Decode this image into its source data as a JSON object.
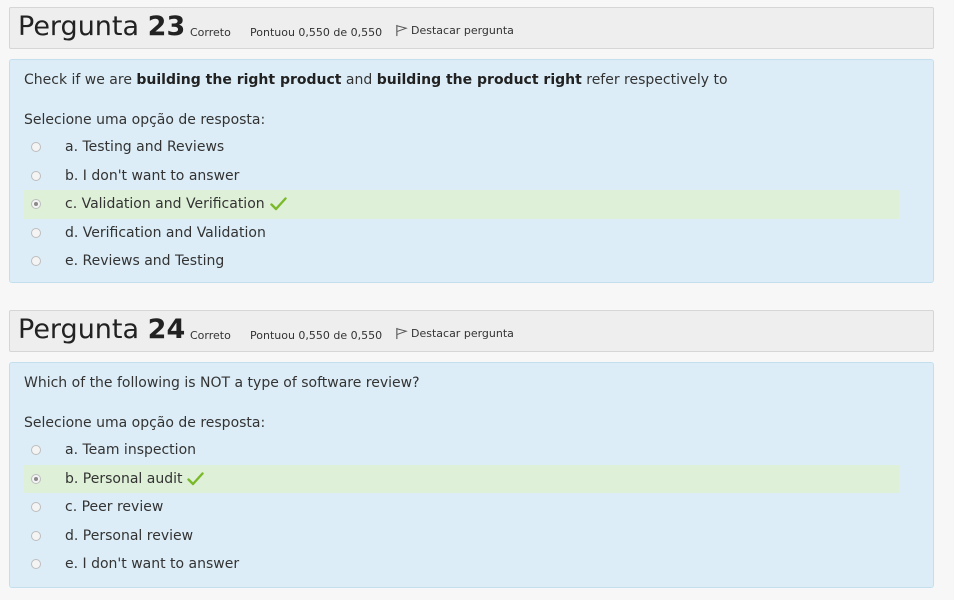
{
  "questions": [
    {
      "title_word": "Pergunta",
      "number": "23",
      "state": "Correto",
      "grade": "Pontuou 0,550 de 0,550",
      "flag_label": "Destacar pergunta",
      "text_parts": [
        "Check if we are ",
        "building the right product",
        " and ",
        "building the product right",
        " refer respectively to"
      ],
      "prompt": "Selecione uma opção de resposta:",
      "options": [
        {
          "label": "a. Testing and Reviews",
          "selected": false,
          "correct": false
        },
        {
          "label": "b. I don't want to answer",
          "selected": false,
          "correct": false
        },
        {
          "label": "c. Validation and Verification",
          "selected": true,
          "correct": true
        },
        {
          "label": "d. Verification and Validation",
          "selected": false,
          "correct": false
        },
        {
          "label": "e. Reviews and Testing",
          "selected": false,
          "correct": false
        }
      ]
    },
    {
      "title_word": "Pergunta",
      "number": "24",
      "state": "Correto",
      "grade": "Pontuou 0,550 de 0,550",
      "flag_label": "Destacar pergunta",
      "text": "Which of the following is NOT a type of software review?",
      "prompt": "Selecione uma opção de resposta:",
      "options": [
        {
          "label": "a. Team inspection",
          "selected": false,
          "correct": false
        },
        {
          "label": "b. Personal audit",
          "selected": true,
          "correct": true
        },
        {
          "label": "c. Peer review",
          "selected": false,
          "correct": false
        },
        {
          "label": "d. Personal review",
          "selected": false,
          "correct": false
        },
        {
          "label": "e. I don't want to answer",
          "selected": false,
          "correct": false
        }
      ]
    }
  ],
  "icons": {
    "flag": "flag-icon",
    "check": "check-icon"
  },
  "colors": {
    "correct_bg": "#dff0d8",
    "content_bg": "#dcedf7",
    "check": "#7ab929"
  }
}
